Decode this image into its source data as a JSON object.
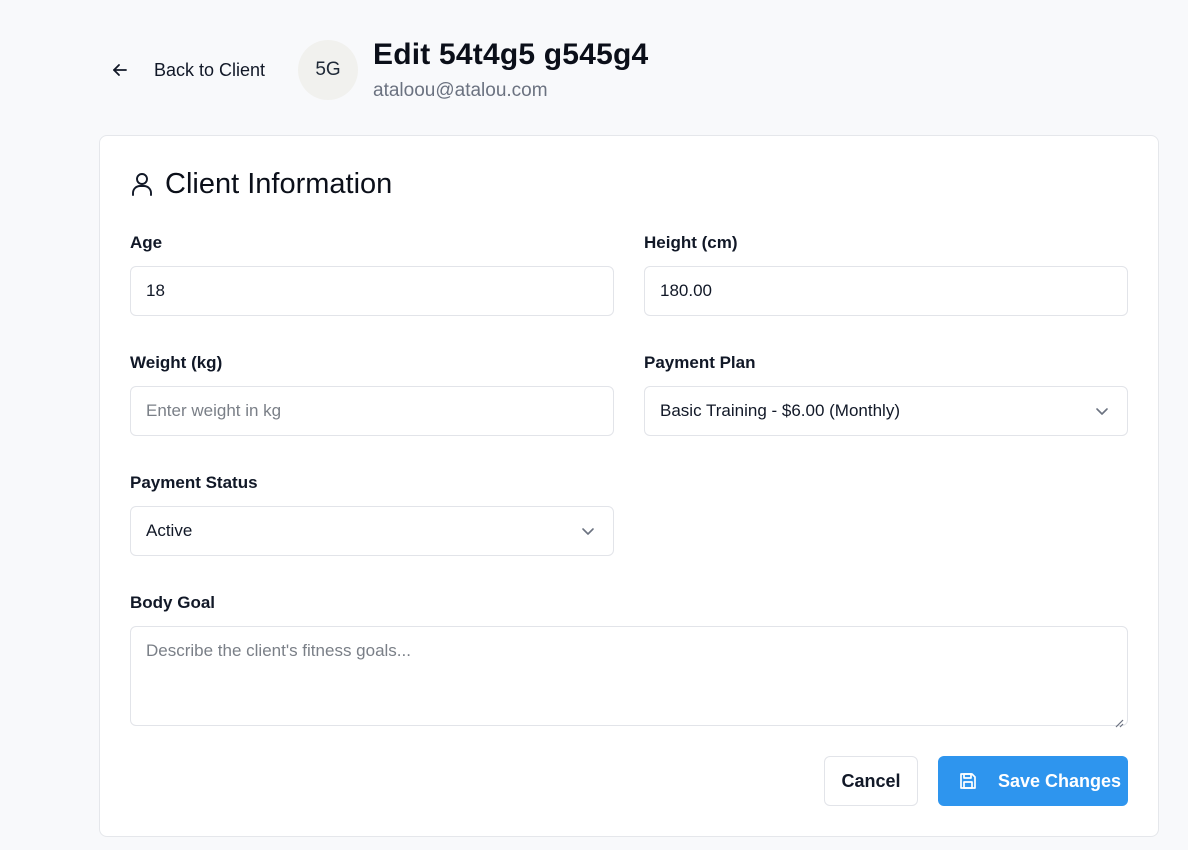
{
  "header": {
    "back_label": "Back to Client",
    "avatar_initials": "5G",
    "title": "Edit 54t4g5 g545g4",
    "email": "ataloou@atalou.com"
  },
  "section": {
    "title": "Client Information"
  },
  "form": {
    "age": {
      "label": "Age",
      "value": "18"
    },
    "height": {
      "label": "Height (cm)",
      "value": "180.00"
    },
    "weight": {
      "label": "Weight (kg)",
      "placeholder": "Enter weight in kg"
    },
    "payment_plan": {
      "label": "Payment Plan",
      "selected": "Basic Training - $6.00 (Monthly)"
    },
    "payment_status": {
      "label": "Payment Status",
      "selected": "Active"
    },
    "body_goal": {
      "label": "Body Goal",
      "placeholder": "Describe the client's fitness goals..."
    }
  },
  "actions": {
    "cancel_label": "Cancel",
    "save_label": "Save Changes"
  },
  "icons": {
    "back": "arrow-left-icon",
    "section": "user-icon",
    "dropdown": "chevron-down-icon",
    "save": "save-icon"
  },
  "colors": {
    "primary": "#2e95ee",
    "background": "#f8f9fb",
    "avatar_bg": "#f1f1ee"
  }
}
